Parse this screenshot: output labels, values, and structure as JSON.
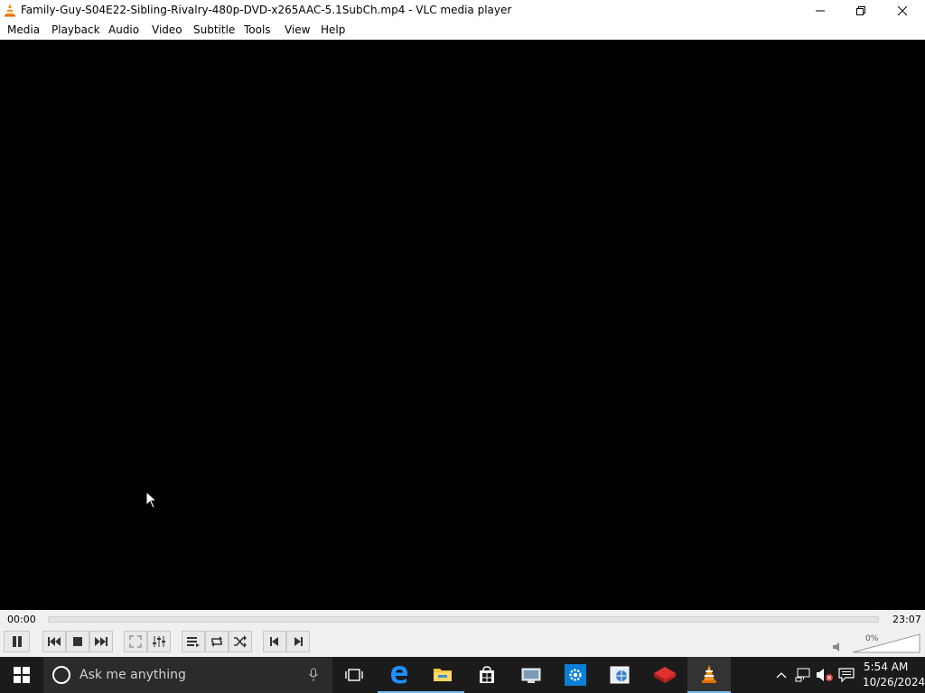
{
  "window": {
    "title": "Family-Guy-S04E22-Sibling-Rivalry-480p-DVD-x265AAC-5.1SubCh.mp4 - VLC media player",
    "app_icon": "vlc-cone-icon",
    "buttons": [
      "minimize-icon",
      "restore-icon",
      "close-icon"
    ]
  },
  "menu": {
    "items": [
      "Media",
      "Playback",
      "Audio",
      "Video",
      "Subtitle",
      "Tools",
      "View",
      "Help"
    ]
  },
  "player": {
    "elapsed": "00:00",
    "duration": "23:07",
    "progress": 0,
    "volume_label": "0%",
    "volume": 0,
    "seek_color": "#7fbf3f"
  },
  "controls": {
    "buttons": [
      "pause-icon",
      "previous-icon",
      "stop-icon",
      "next-icon",
      "fullscreen-icon",
      "extended-settings-icon",
      "playlist-icon",
      "loop-icon",
      "shuffle-icon",
      "frame-prev-icon",
      "frame-next-icon"
    ]
  },
  "taskbar": {
    "search_placeholder": "Ask me anything",
    "apps": [
      "task-view-icon",
      "edge-icon",
      "file-explorer-icon",
      "store-icon",
      "system-icon",
      "settings-icon",
      "web-browser-icon",
      "app-red-icon",
      "vlc-icon"
    ],
    "clock_time": "5:54 AM",
    "clock_date": "10/26/2024",
    "accent": "#1b1b1b"
  }
}
